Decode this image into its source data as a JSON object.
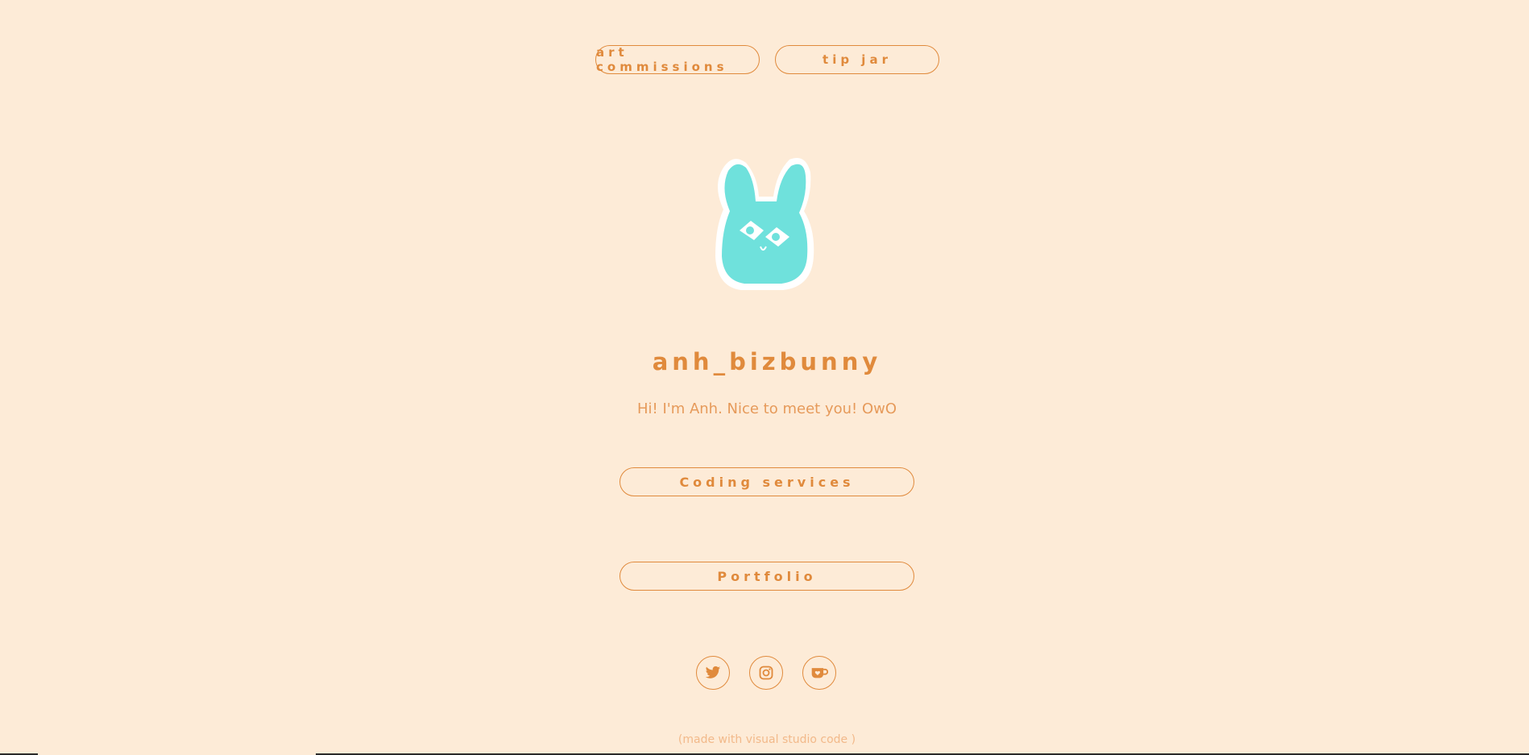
{
  "nav": {
    "art_commissions": "art commissions",
    "tip_jar": "tip jar"
  },
  "profile": {
    "username": "anh_bizbunny",
    "bio": "Hi! I'm Anh. Nice to meet you! OwO",
    "avatar_icon": "bunny-avatar-icon"
  },
  "links": {
    "coding": "Coding services",
    "portfolio": "Portfolio"
  },
  "socials": [
    "twitter-icon",
    "instagram-icon",
    "kofi-icon"
  ],
  "footer": "(made with visual studio code )",
  "colors": {
    "background": "#fdebd7",
    "accent": "#e08a3c",
    "avatar": "#6fe1dc"
  }
}
